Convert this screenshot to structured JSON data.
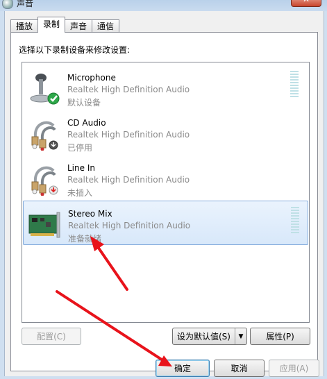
{
  "window": {
    "title": "声音"
  },
  "tabs": [
    {
      "label": "播放",
      "active": false
    },
    {
      "label": "录制",
      "active": true
    },
    {
      "label": "声音",
      "active": false
    },
    {
      "label": "通信",
      "active": false
    }
  ],
  "instruction": "选择以下录制设备来修改设置:",
  "devices": [
    {
      "name": "Microphone",
      "driver": "Realtek High Definition Audio",
      "status": "默认设备",
      "icon": "microphone-icon",
      "badge": "default-check"
    },
    {
      "name": "CD Audio",
      "driver": "Realtek High Definition Audio",
      "status": "已停用",
      "icon": "audio-cable-icon",
      "badge": "disabled-arrow"
    },
    {
      "name": "Line In",
      "driver": "Realtek High Definition Audio",
      "status": "未插入",
      "icon": "audio-cable-icon",
      "badge": "unplugged-arrow"
    },
    {
      "name": "Stereo Mix",
      "driver": "Realtek High Definition Audio",
      "status": "准备就绪",
      "icon": "sound-card-icon",
      "badge": "none",
      "selected": true
    }
  ],
  "buttons": {
    "configure": "配置(C)",
    "set_default": "设为默认值(S)",
    "properties": "属性(P)",
    "ok": "确定",
    "cancel": "取消",
    "apply": "应用(A)"
  },
  "colors": {
    "annotation_arrow": "#e8131b",
    "selection": "#d8e8fa"
  }
}
